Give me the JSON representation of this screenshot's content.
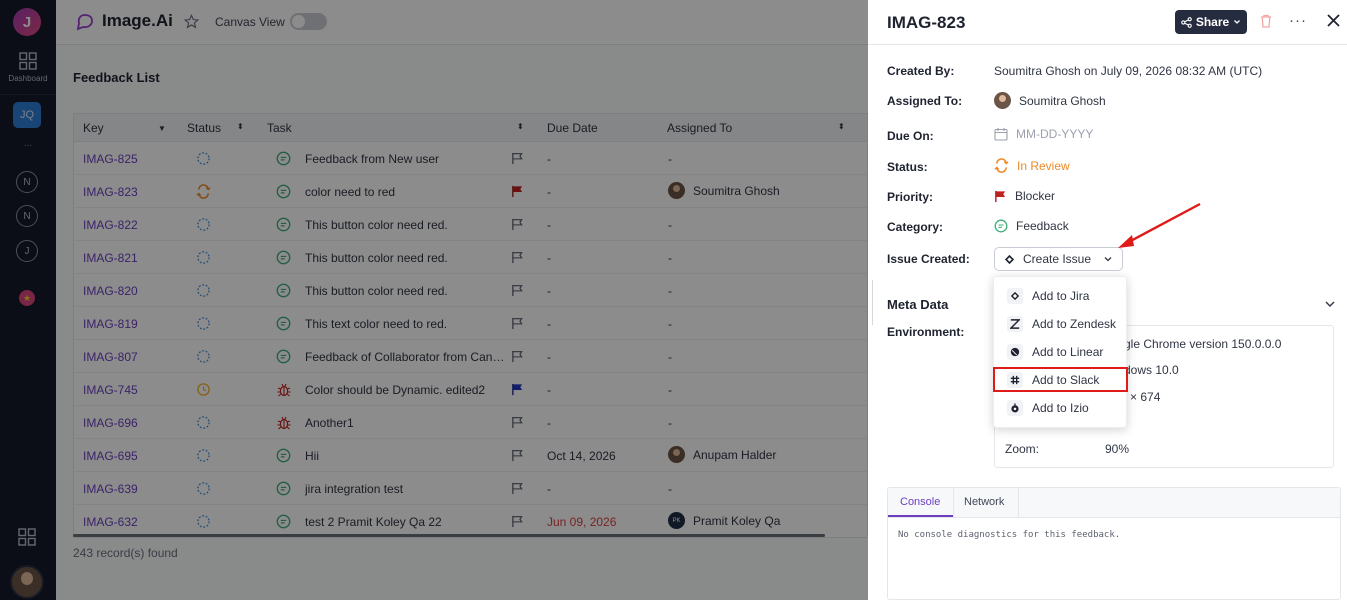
{
  "rail": {
    "logo_letter": "J",
    "dashboard_label": "Dashboard",
    "workspace_badge": "JQ",
    "more": "...",
    "workspaces": [
      "N",
      "N",
      "J"
    ]
  },
  "project": {
    "name": "Image.Ai",
    "canvas_view_label": "Canvas View"
  },
  "list": {
    "title": "Feedback List",
    "columns": [
      "Key",
      "Status",
      "Task",
      "Due Date",
      "Assigned To"
    ],
    "rows": [
      {
        "key": "IMAG-825",
        "task": "Feedback from New user",
        "due": "-",
        "assigned": "-",
        "status": "open",
        "type": "feedback",
        "flag": "none"
      },
      {
        "key": "IMAG-823",
        "task": "color need to red",
        "due": "-",
        "assigned": "Soumitra Ghosh",
        "status": "in-review",
        "type": "feedback",
        "flag": "blocker"
      },
      {
        "key": "IMAG-822",
        "task": "This button color need red.",
        "due": "-",
        "assigned": "-",
        "status": "open",
        "type": "feedback",
        "flag": "none"
      },
      {
        "key": "IMAG-821",
        "task": "This button color need red.",
        "due": "-",
        "assigned": "-",
        "status": "open",
        "type": "feedback",
        "flag": "none"
      },
      {
        "key": "IMAG-820",
        "task": "This button color need red.",
        "due": "-",
        "assigned": "-",
        "status": "open",
        "type": "feedback",
        "flag": "none"
      },
      {
        "key": "IMAG-819",
        "task": "This text color need to red.",
        "due": "-",
        "assigned": "-",
        "status": "open",
        "type": "feedback",
        "flag": "none"
      },
      {
        "key": "IMAG-807",
        "task": "Feedback of Collaborator from Canvas",
        "due": "-",
        "assigned": "-",
        "status": "open",
        "type": "feedback",
        "flag": "none"
      },
      {
        "key": "IMAG-745",
        "task": "Color should be Dynamic. edited2",
        "due": "-",
        "assigned": "-",
        "status": "pending",
        "type": "bug",
        "flag": "high"
      },
      {
        "key": "IMAG-696",
        "task": "Another1",
        "due": "-",
        "assigned": "-",
        "status": "open",
        "type": "bug",
        "flag": "none"
      },
      {
        "key": "IMAG-695",
        "task": "Hii",
        "due": "Oct 14, 2026",
        "assigned": "Anupam Halder",
        "status": "open",
        "type": "feedback",
        "flag": "none"
      },
      {
        "key": "IMAG-639",
        "task": "jira integration test",
        "due": "-",
        "assigned": "-",
        "status": "open",
        "type": "feedback",
        "flag": "none"
      },
      {
        "key": "IMAG-632",
        "task": "test 2 Pramit Koley Qa 22",
        "due": "Jun 09, 2026",
        "assigned": "Pramit Koley Qa",
        "assigned_initials": "PK",
        "status": "open",
        "type": "feedback",
        "flag": "none",
        "overdue": true
      }
    ],
    "records": "243 record(s) found"
  },
  "panel": {
    "title": "IMAG-823",
    "share_label": "Share",
    "fields": {
      "created_by_label": "Created By:",
      "created_by": "Soumitra Ghosh on July 09, 2026 08:32 AM (UTC)",
      "assigned_to_label": "Assigned To:",
      "assigned_to": "Soumitra Ghosh",
      "due_on_label": "Due On:",
      "due_on_placeholder": "MM-DD-YYYY",
      "status_label": "Status:",
      "status": "In Review",
      "priority_label": "Priority:",
      "priority": "Blocker",
      "category_label": "Category:",
      "category": "Feedback",
      "issue_created_label": "Issue Created:",
      "issue_button": "Create Issue"
    },
    "meta_title": "Meta Data",
    "environment_label": "Environment:",
    "environment": {
      "browser_partial": "gle Chrome version 150.0.0.0",
      "os_partial": "dows 10.0",
      "resolution_partial": "× 674",
      "zoom_label": "Zoom:",
      "zoom": "90%"
    },
    "tabs": [
      "Console",
      "Network"
    ],
    "console_message": "No console diagnostics for this feedback."
  },
  "dropdown": {
    "items": [
      "Add to Jira",
      "Add to Zendesk",
      "Add to Linear",
      "Add to Slack",
      "Add to Izio"
    ],
    "highlighted": "Add to Slack"
  },
  "colors": {
    "accent": "#6b3fc0",
    "status_in_review": "#f08a28",
    "blocker": "#c0221f",
    "annotation": "#e01919"
  }
}
